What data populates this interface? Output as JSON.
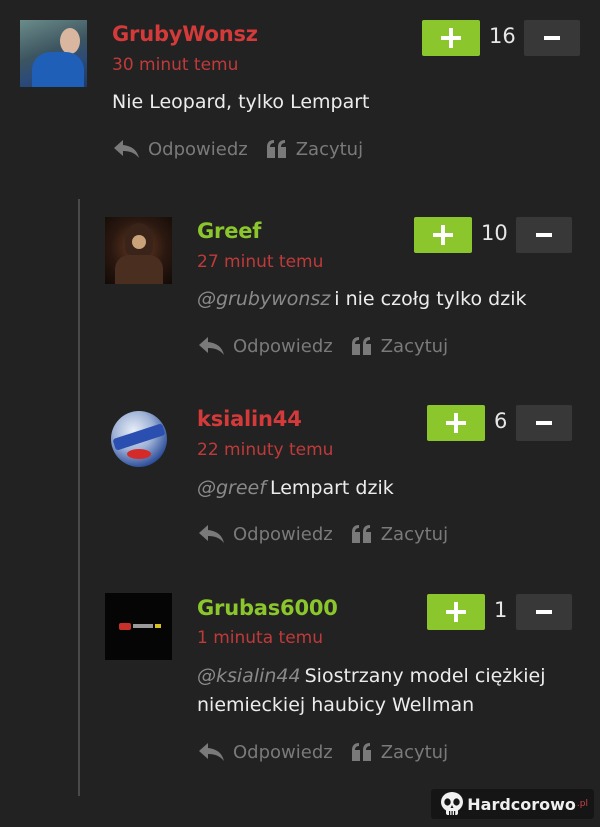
{
  "comments": [
    {
      "username": "GrubyWonsz",
      "time": "30 minut temu",
      "mention": "",
      "text": "Nie Leopard, tylko Lempart",
      "score": "16",
      "reply_label": "Odpowiedz",
      "quote_label": "Zacytuj"
    },
    {
      "username": "Greef",
      "time": "27 minut temu",
      "mention": "@grubywonsz",
      "text": "i nie czołg tylko dzik",
      "score": "10",
      "reply_label": "Odpowiedz",
      "quote_label": "Zacytuj"
    },
    {
      "username": "ksialin44",
      "time": "22 minuty temu",
      "mention": "@greef",
      "text": "Lempart dzik",
      "score": "6",
      "reply_label": "Odpowiedz",
      "quote_label": "Zacytuj"
    },
    {
      "username": "Grubas6000",
      "time": "1 minuta temu",
      "mention": "@ksialin44",
      "text": "Siostrzany model ciężkiej niemieckiej haubicy Wellman",
      "score": "1",
      "reply_label": "Odpowiedz",
      "quote_label": "Zacytuj"
    }
  ],
  "colors": {
    "background": "#222222",
    "plus_button": "#8bc72c",
    "minus_button": "#383838",
    "username_red": "#d43a3a",
    "username_green": "#8bc72c"
  },
  "watermark": {
    "text": "Hardcorowo",
    "suffix": ".pl"
  }
}
